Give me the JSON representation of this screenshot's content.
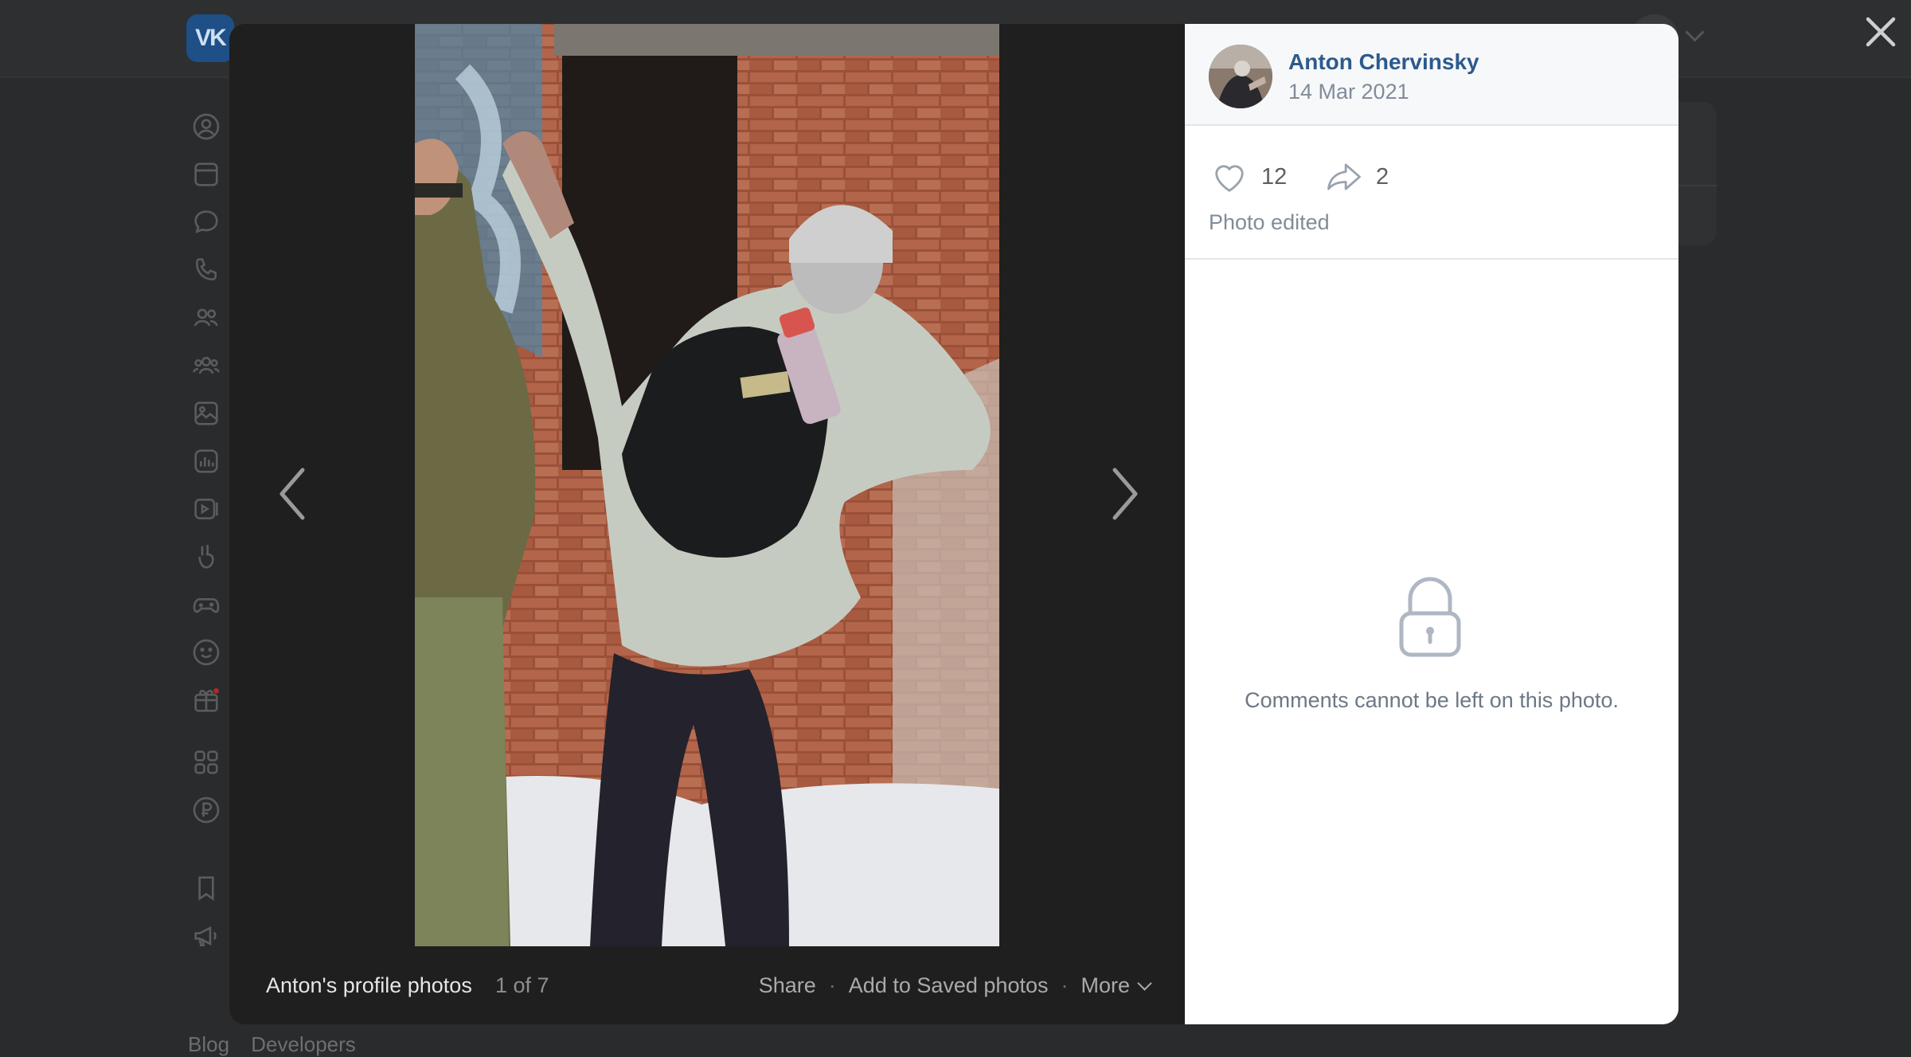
{
  "background_page": {
    "logo_text": "VK",
    "sidebar_icons": [
      "profile-icon",
      "news-icon",
      "messages-icon",
      "calls-icon",
      "friends-icon",
      "communities-icon",
      "photos-icon",
      "music-icon",
      "video-icon",
      "clips-icon",
      "games-icon",
      "stickers-icon",
      "gifts-icon",
      "services-icon",
      "vk-pay-icon",
      "bookmarks-icon",
      "ads-icon"
    ],
    "footer_links": [
      "Blog",
      "Developers"
    ]
  },
  "viewer": {
    "album_title": "Anton's profile photos",
    "counter": "1 of 7",
    "actions": {
      "share": "Share",
      "separator": "·",
      "save": "Add to Saved photos",
      "more": "More"
    }
  },
  "panel": {
    "author_name": "Anton Chervinsky",
    "date": "14 Mar 2021",
    "likes": "12",
    "shares": "2",
    "edited_note": "Photo edited",
    "comments_note": "Comments cannot be left on this photo."
  },
  "colors": {
    "link": "#2c5a8c",
    "muted": "#818c99",
    "overlay": "#2a2b2c"
  }
}
